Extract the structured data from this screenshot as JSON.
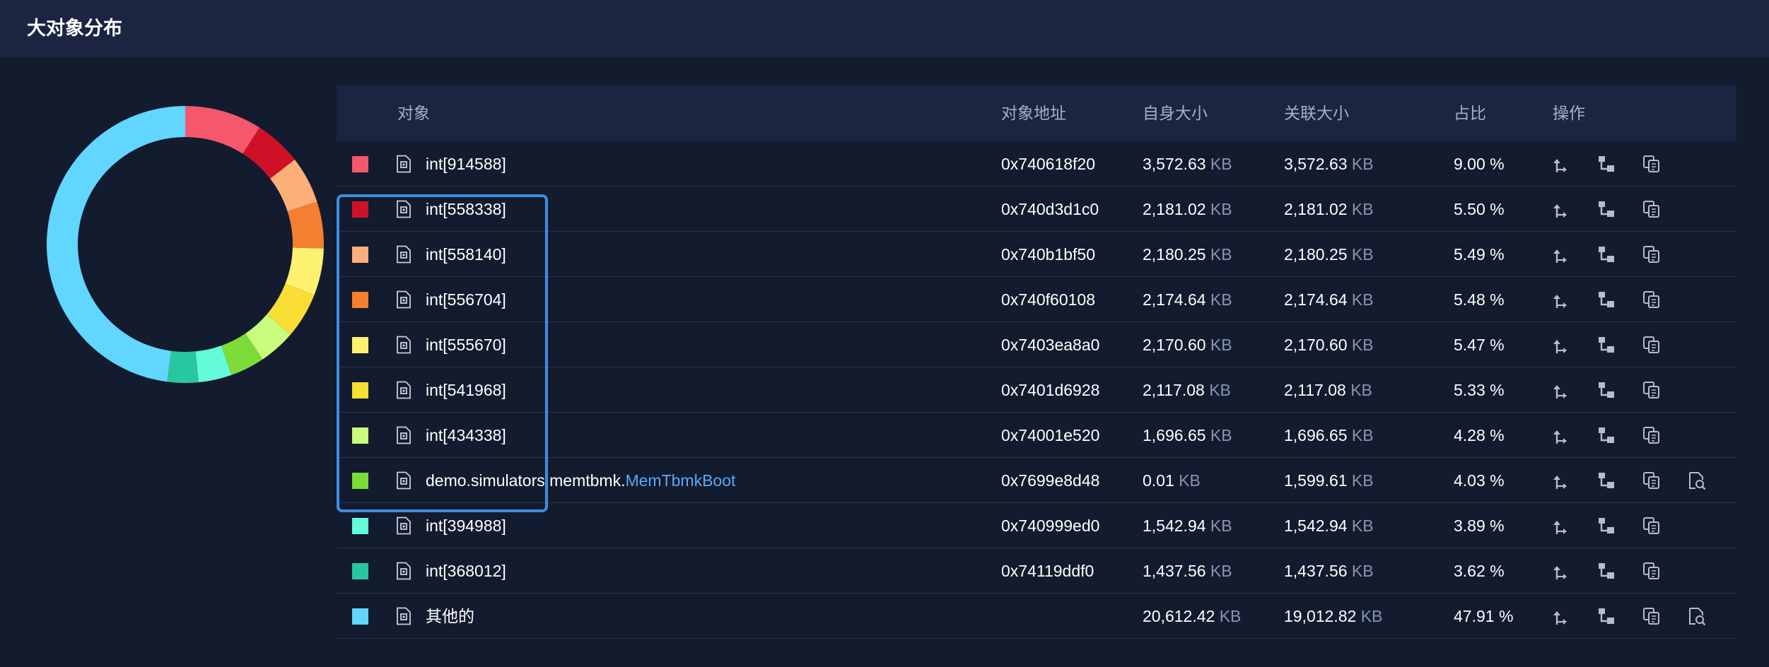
{
  "header": {
    "title": "大对象分布"
  },
  "table": {
    "columns": {
      "object": "对象",
      "address": "对象地址",
      "self_size": "自身大小",
      "retained_size": "关联大小",
      "ratio": "占比",
      "actions": "操作"
    },
    "unit": "KB",
    "rows": [
      {
        "color": "#f4586a",
        "name": "int[914588]",
        "name_link": "",
        "address": "0x740618f20",
        "self": "3,572.63",
        "retained": "3,572.63",
        "ratio": "9.00 %",
        "percent": 9.0,
        "inspect": false
      },
      {
        "color": "#cf1128",
        "name": "int[558338]",
        "name_link": "",
        "address": "0x740d3d1c0",
        "self": "2,181.02",
        "retained": "2,181.02",
        "ratio": "5.50 %",
        "percent": 5.5,
        "inspect": false
      },
      {
        "color": "#fbb07a",
        "name": "int[558140]",
        "name_link": "",
        "address": "0x740b1bf50",
        "self": "2,180.25",
        "retained": "2,180.25",
        "ratio": "5.49 %",
        "percent": 5.49,
        "inspect": false
      },
      {
        "color": "#f57f30",
        "name": "int[556704]",
        "name_link": "",
        "address": "0x740f60108",
        "self": "2,174.64",
        "retained": "2,174.64",
        "ratio": "5.48 %",
        "percent": 5.48,
        "inspect": false
      },
      {
        "color": "#fdf26f",
        "name": "int[555670]",
        "name_link": "",
        "address": "0x7403ea8a0",
        "self": "2,170.60",
        "retained": "2,170.60",
        "ratio": "5.47 %",
        "percent": 5.47,
        "inspect": false
      },
      {
        "color": "#f8de35",
        "name": "int[541968]",
        "name_link": "",
        "address": "0x7401d6928",
        "self": "2,117.08",
        "retained": "2,117.08",
        "ratio": "5.33 %",
        "percent": 5.33,
        "inspect": false
      },
      {
        "color": "#c9fb7c",
        "name": "int[434338]",
        "name_link": "",
        "address": "0x74001e520",
        "self": "1,696.65",
        "retained": "1,696.65",
        "ratio": "4.28 %",
        "percent": 4.28,
        "inspect": false
      },
      {
        "color": "#7ddc3a",
        "name": "demo.simulators.memtbmk.",
        "name_link": "MemTbmkBoot",
        "address": "0x7699e8d48",
        "self": "0.01",
        "retained": "1,599.61",
        "ratio": "4.03 %",
        "percent": 4.03,
        "inspect": true
      },
      {
        "color": "#64fbd9",
        "name": "int[394988]",
        "name_link": "",
        "address": "0x740999ed0",
        "self": "1,542.94",
        "retained": "1,542.94",
        "ratio": "3.89 %",
        "percent": 3.89,
        "inspect": false
      },
      {
        "color": "#27c7a0",
        "name": "int[368012]",
        "name_link": "",
        "address": "0x74119ddf0",
        "self": "1,437.56",
        "retained": "1,437.56",
        "ratio": "3.62 %",
        "percent": 3.62,
        "inspect": false
      },
      {
        "color": "#61d6ff",
        "name": "其他的",
        "name_link": "",
        "address": "",
        "self": "20,612.42",
        "retained": "19,012.82",
        "ratio": "47.91 %",
        "percent": 47.91,
        "inspect": true
      }
    ]
  },
  "icons": {
    "object": "document-icon",
    "actions": [
      "outgoing-reference-icon",
      "incoming-reference-icon",
      "copy-icon",
      "inspect-icon"
    ]
  },
  "colors": {
    "highlight_border": "#3d8fe0",
    "link": "#5aa9f5",
    "background": "#131b2e",
    "header_bg": "#1b2440"
  }
}
